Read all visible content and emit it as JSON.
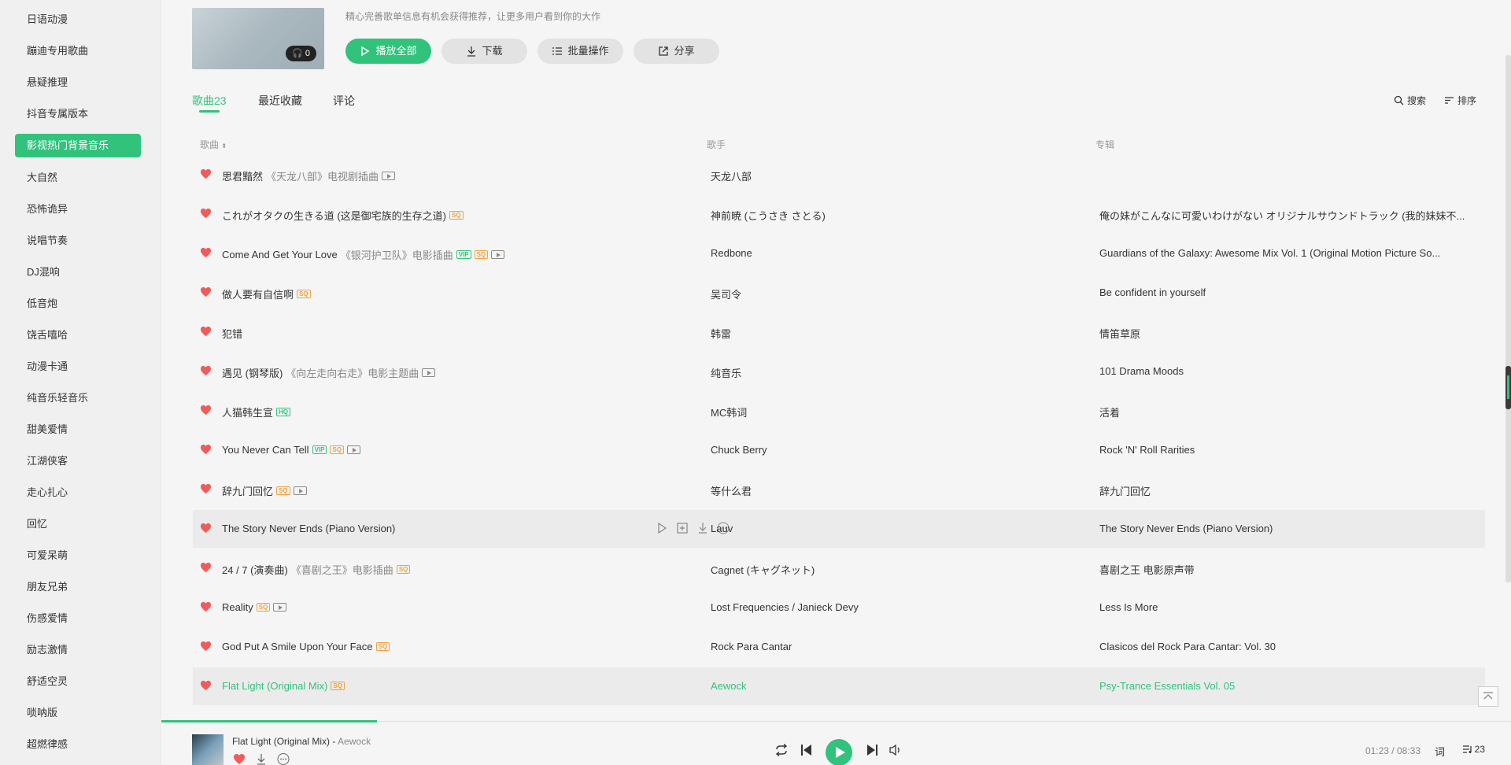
{
  "sidebar": {
    "items": [
      {
        "label": "日语动漫",
        "active": false
      },
      {
        "label": "蹦迪专用歌曲",
        "active": false
      },
      {
        "label": "悬疑推理",
        "active": false
      },
      {
        "label": "抖音专属版本",
        "active": false
      },
      {
        "label": "影视热门背景音乐",
        "active": true
      },
      {
        "label": "大自然",
        "active": false
      },
      {
        "label": "恐怖诡异",
        "active": false
      },
      {
        "label": "说唱节奏",
        "active": false
      },
      {
        "label": "DJ混响",
        "active": false
      },
      {
        "label": "低音炮",
        "active": false
      },
      {
        "label": "饶舌嘻哈",
        "active": false
      },
      {
        "label": "动漫卡通",
        "active": false
      },
      {
        "label": "纯音乐轻音乐",
        "active": false
      },
      {
        "label": "甜美爱情",
        "active": false
      },
      {
        "label": "江湖侠客",
        "active": false
      },
      {
        "label": "走心扎心",
        "active": false
      },
      {
        "label": "回忆",
        "active": false
      },
      {
        "label": "可爱呆萌",
        "active": false
      },
      {
        "label": "朋友兄弟",
        "active": false
      },
      {
        "label": "伤感爱情",
        "active": false
      },
      {
        "label": "励志激情",
        "active": false
      },
      {
        "label": "舒适空灵",
        "active": false
      },
      {
        "label": "唢呐版",
        "active": false
      },
      {
        "label": "超燃律感",
        "active": false
      }
    ]
  },
  "playlist": {
    "cover_badge": "0",
    "description": "精心完善歌单信息有机会获得推荐，让更多用户看到你的大作",
    "buttons": {
      "play_all": "播放全部",
      "download": "下载",
      "batch": "批量操作",
      "share": "分享"
    }
  },
  "tabs": {
    "songs": "歌曲23",
    "recent": "最近收藏",
    "comments": "评论"
  },
  "tools": {
    "search": "搜索",
    "sort": "排序"
  },
  "columns": {
    "song": "歌曲",
    "singer": "歌手",
    "album": "专辑"
  },
  "songs": [
    {
      "title": "思君黯然",
      "sub": "《天龙八部》电视剧插曲",
      "tags": [
        "mv"
      ],
      "singer": "天龙八部",
      "album": ""
    },
    {
      "title": "これがオタクの生きる道 (这是御宅族的生存之道)",
      "sub": "",
      "tags": [
        "sq"
      ],
      "singer": "神前暁 (こうさき さとる)",
      "album": "俺の妹がこんなに可愛いわけがない オリジナルサウンドトラック (我的妹妹不..."
    },
    {
      "title": "Come And Get Your Love",
      "sub": "《银河护卫队》电影插曲",
      "tags": [
        "vip",
        "sq",
        "mv"
      ],
      "singer": "Redbone",
      "album": "Guardians of the Galaxy: Awesome Mix Vol. 1 (Original Motion Picture So..."
    },
    {
      "title": "做人要有自信啊",
      "sub": "",
      "tags": [
        "sq"
      ],
      "singer": "吴司令",
      "album": "Be confident in yourself"
    },
    {
      "title": "犯错",
      "sub": "",
      "tags": [],
      "singer": "韩雷",
      "album": "情笛草原"
    },
    {
      "title": "遇见 (钢琴版)",
      "sub": "《向左走向右走》电影主题曲",
      "tags": [
        "mv"
      ],
      "singer": "纯音乐",
      "album": "101 Drama Moods"
    },
    {
      "title": "人猫韩生宣",
      "sub": "",
      "tags": [
        "hq"
      ],
      "singer": "MC韩词",
      "album": "活着"
    },
    {
      "title": "You Never Can Tell",
      "sub": "",
      "tags": [
        "vip",
        "sq",
        "mv"
      ],
      "singer": "Chuck Berry",
      "album": "Rock 'N' Roll Rarities"
    },
    {
      "title": "辞九门回忆",
      "sub": "",
      "tags": [
        "sq",
        "mv"
      ],
      "singer": "等什么君",
      "album": "辞九门回忆"
    },
    {
      "title": "The Story Never Ends (Piano Version)",
      "sub": "",
      "tags": [],
      "singer": "Lauv",
      "album": "The Story Never Ends (Piano Version)"
    },
    {
      "title": "24 / 7 (演奏曲)",
      "sub": "《喜剧之王》电影插曲",
      "tags": [
        "sq"
      ],
      "singer": "Cagnet (キャグネット)",
      "album": "喜剧之王 电影原声带"
    },
    {
      "title": "Reality",
      "sub": "",
      "tags": [
        "sq",
        "mv"
      ],
      "singer": "Lost Frequencies / Janieck Devy",
      "album": "Less Is More"
    },
    {
      "title": "God Put A Smile Upon Your Face",
      "sub": "",
      "tags": [
        "sq"
      ],
      "singer": "Rock Para Cantar",
      "album": "Clasicos del Rock Para Cantar: Vol. 30"
    },
    {
      "title": "Flat Light (Original Mix)",
      "sub": "",
      "tags": [
        "sq"
      ],
      "singer": "Aewock",
      "album": "Psy-Trance Essentials Vol. 05"
    }
  ],
  "tag_labels": {
    "sq": "SQ",
    "vip": "VIP",
    "hq": "HQ"
  },
  "player": {
    "title": "Flat Light (Original Mix)",
    "separator": " - ",
    "singer": "Aewock",
    "time": "01:23 / 08:33",
    "lyric": "词",
    "count": "23",
    "progress": 0.16
  },
  "colors": {
    "accent": "#31c27c",
    "heart": "#f25b5b",
    "tag_sq": "#f0a040"
  }
}
